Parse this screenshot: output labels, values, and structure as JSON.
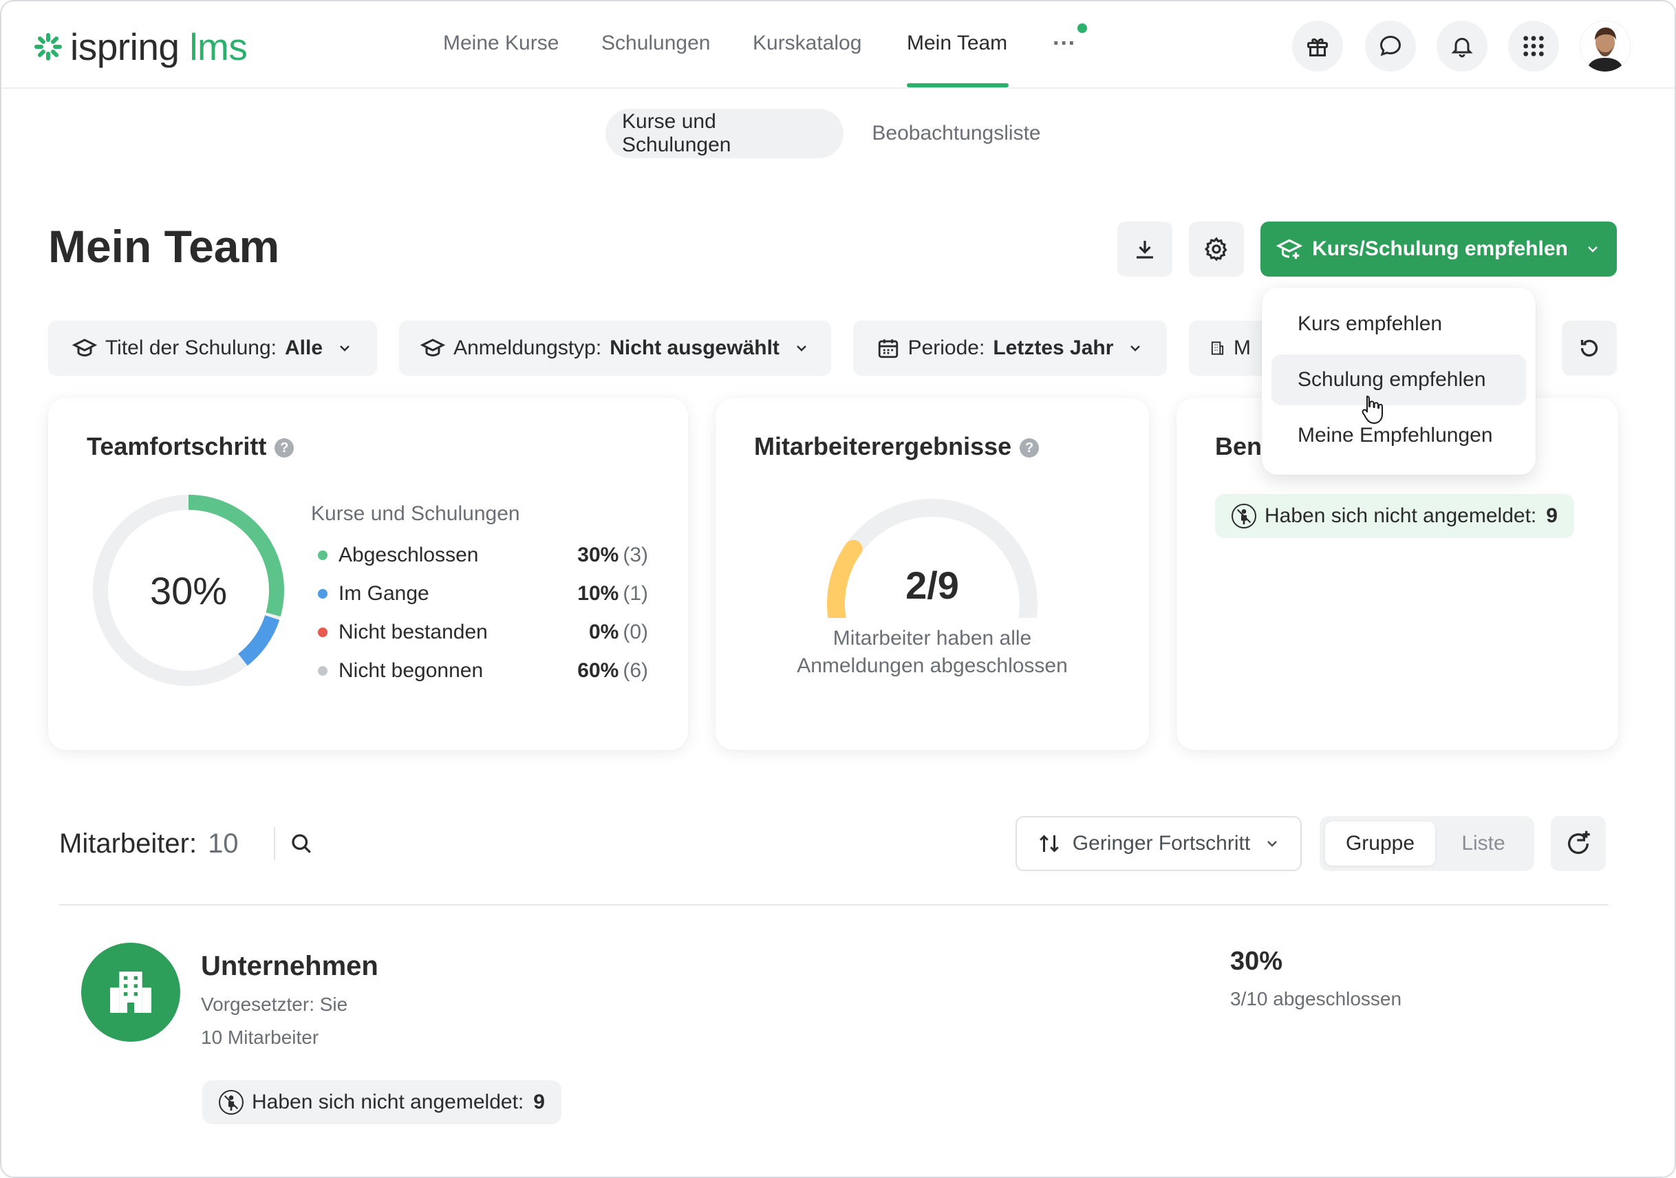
{
  "header": {
    "logo": {
      "brand": "ispring",
      "product": "lms"
    },
    "nav": [
      {
        "label": "Meine Kurse",
        "active": false
      },
      {
        "label": "Schulungen",
        "active": false
      },
      {
        "label": "Kurskatalog",
        "active": false
      },
      {
        "label": "Mein Team",
        "active": true
      }
    ],
    "more_label": "···",
    "icons": [
      "gift-icon",
      "chat-icon",
      "bell-icon",
      "apps-grid-icon"
    ]
  },
  "subtabs": [
    {
      "label": "Kurse und Schulungen",
      "active": true
    },
    {
      "label": "Beobachtungsliste",
      "active": false
    }
  ],
  "page_title": "Mein Team",
  "actions": {
    "recommend_label": "Kurs/Schulung empfehlen",
    "icons": [
      "download-icon",
      "settings-icon"
    ]
  },
  "dropdown": {
    "items": [
      {
        "label": "Kurs empfehlen",
        "hovered": false
      },
      {
        "label": "Schulung empfehlen",
        "hovered": true
      },
      {
        "label": "Meine Empfehlungen",
        "hovered": false
      }
    ]
  },
  "filters": [
    {
      "label": "Titel der Schulung:",
      "value": "Alle",
      "icon": "graduation-cap-icon"
    },
    {
      "label": "Anmeldungstyp:",
      "value": "Nicht ausgewählt",
      "icon": "graduation-cap-icon"
    },
    {
      "label": "Periode:",
      "value": "Letztes Jahr",
      "icon": "calendar-icon"
    },
    {
      "label": "M",
      "value": "",
      "icon": "building-icon"
    }
  ],
  "team_progress": {
    "title": "Teamfortschritt",
    "center_value": "30%",
    "subtitle": "Kurse und Schulungen",
    "rows": [
      {
        "label": "Abgeschlossen",
        "pct": "30%",
        "count": "(3)",
        "color": "#5cc48a",
        "value": 30
      },
      {
        "label": "Im Gange",
        "pct": "10%",
        "count": "(1)",
        "color": "#4d9be6",
        "value": 10
      },
      {
        "label": "Nicht bestanden",
        "pct": "0%",
        "count": "(0)",
        "color": "#e8594f",
        "value": 0
      },
      {
        "label": "Nicht begonnen",
        "pct": "60%",
        "count": "(6)",
        "color": "#c4c7cb",
        "value": 60
      }
    ]
  },
  "employee_results": {
    "title": "Mitarbeiterergebnisse",
    "value": "2/9",
    "fraction": 0.2222,
    "caption_line1": "Mitarbeiter haben alle",
    "caption_line2": "Anmeldungen abgeschlossen",
    "gauge_color": "#ffcc66"
  },
  "third_card": {
    "title_partial": "Ben",
    "chip_label": "Haben sich nicht angemeldet:",
    "chip_value": "9"
  },
  "employees": {
    "label": "Mitarbeiter:",
    "count": "10",
    "sort_label": "Geringer Fortschritt",
    "view_toggle": [
      {
        "label": "Gruppe",
        "active": true
      },
      {
        "label": "Liste",
        "active": false
      }
    ]
  },
  "group": {
    "name": "Unternehmen",
    "manager": "Vorgesetzter: Sie",
    "members": "10 Mitarbeiter",
    "chip_label": "Haben sich nicht angemeldet:",
    "chip_value": "9",
    "progress_pct": "30%",
    "progress_detail": "3/10 abgeschlossen"
  },
  "colors": {
    "brand_green": "#2bb16c",
    "button_green": "#2e9e5b",
    "chip_green_bg": "#e9f7ee"
  }
}
